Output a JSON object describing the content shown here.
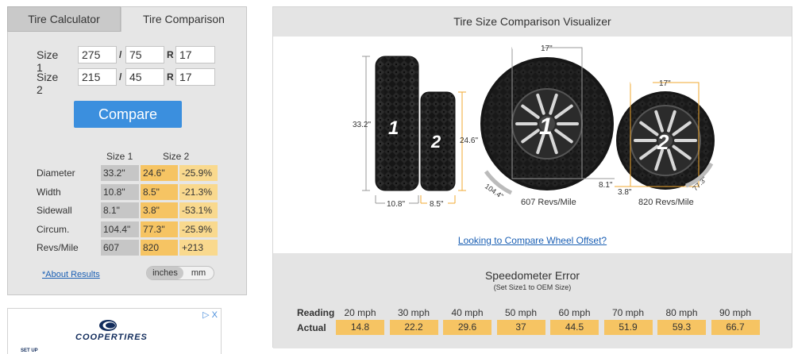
{
  "tabs": {
    "calculator": "Tire Calculator",
    "comparison": "Tire Comparison"
  },
  "size1": {
    "label": "Size 1",
    "width": "275",
    "ratio": "75",
    "rim": "17"
  },
  "size2": {
    "label": "Size 2",
    "width": "215",
    "ratio": "45",
    "rim": "17"
  },
  "separators": {
    "slash": "/",
    "r": "R"
  },
  "compare_label": "Compare",
  "results": {
    "col1": "Size 1",
    "col2": "Size 2",
    "rows": [
      {
        "label": "Diameter",
        "v1": "33.2\"",
        "v2": "24.6\"",
        "diff": "-25.9%"
      },
      {
        "label": "Width",
        "v1": "10.8\"",
        "v2": "8.5\"",
        "diff": "-21.3%"
      },
      {
        "label": "Sidewall",
        "v1": "8.1\"",
        "v2": "3.8\"",
        "diff": "-53.1%"
      },
      {
        "label": "Circum.",
        "v1": "104.4\"",
        "v2": "77.3\"",
        "diff": "-25.9%"
      },
      {
        "label": "Revs/Mile",
        "v1": "607",
        "v2": "820",
        "diff": "+213"
      }
    ]
  },
  "about_link": "*About Results",
  "units": {
    "inches": "inches",
    "mm": "mm"
  },
  "ad": {
    "brand": "COOPERTIRES",
    "tagline": "SET UP",
    "close": "▷ X"
  },
  "visualizer": {
    "title": "Tire Size Comparison Visualizer",
    "tire1": {
      "number": "1",
      "diameter": "33.2\"",
      "width": "10.8\"",
      "rim": "17\"",
      "sidewall": "8.1\"",
      "circumference": "104.4\"",
      "revs": "607 Revs/Mile"
    },
    "tire2": {
      "number": "2",
      "diameter": "24.6\"",
      "width": "8.5\"",
      "rim": "17\"",
      "sidewall": "3.8\"",
      "circumference": "77.3\"",
      "revs": "820 Revs/Mile"
    },
    "offset_link": "Looking to Compare Wheel Offset?"
  },
  "speedometer": {
    "title": "Speedometer Error",
    "subtitle": "(Set Size1 to OEM Size)",
    "reading_label": "Reading",
    "actual_label": "Actual",
    "readings": [
      "20 mph",
      "30 mph",
      "40 mph",
      "50 mph",
      "60 mph",
      "70 mph",
      "80 mph",
      "90 mph"
    ],
    "actuals": [
      "14.8",
      "22.2",
      "29.6",
      "37",
      "44.5",
      "51.9",
      "59.3",
      "66.7"
    ]
  },
  "colors": {
    "accent": "#3b8fde",
    "size2_highlight": "#f6c463",
    "diff_highlight": "#f9d98e",
    "size1_cell": "#c6c6c6",
    "dimension_line": "#f0a830"
  }
}
